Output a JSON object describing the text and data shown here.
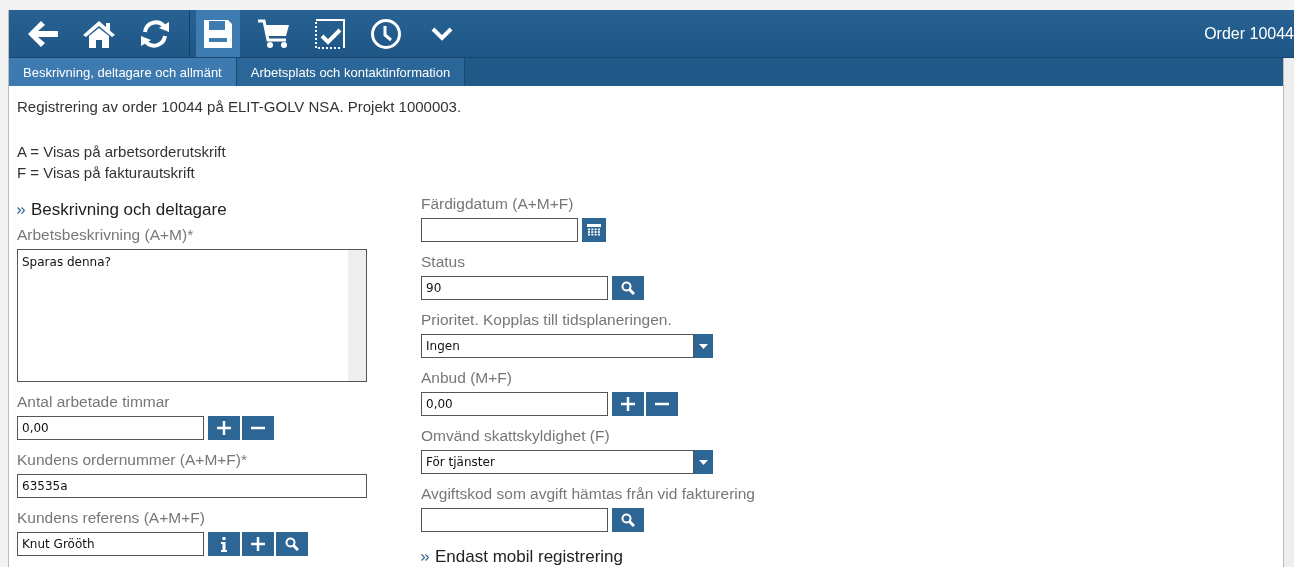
{
  "toolbar": {
    "buttons": [
      {
        "kind": "back",
        "selected": false
      },
      {
        "kind": "home",
        "selected": false
      },
      {
        "kind": "refresh",
        "selected": false
      },
      {
        "kind": "save",
        "selected": true
      },
      {
        "kind": "cart",
        "selected": false
      },
      {
        "kind": "check",
        "selected": false
      },
      {
        "kind": "clock",
        "selected": false
      },
      {
        "kind": "more",
        "selected": false
      }
    ],
    "title": "Order 10044"
  },
  "tabs": [
    {
      "label": "Beskrivning, deltagare och allmänt",
      "selected": true
    },
    {
      "label": "Arbetsplats och kontaktinformation",
      "selected": false
    }
  ],
  "intro": [
    "Registrering av order 10044 på ELIT-GOLV NSA. Projekt 1000003."
  ],
  "legend": [
    "A = Visas på arbetsorderutskrift",
    "F = Visas på fakturautskrift"
  ],
  "left": {
    "heading": "Beskrivning och deltagare",
    "fields": [
      {
        "kind": "textarea",
        "label": "Arbetsbeskrivning (A+M)*",
        "value": "Sparas denna?"
      },
      {
        "kind": "short",
        "label": "Antal arbetade timmar",
        "value": "0,00",
        "buttons": [
          {
            "kind": "plus"
          },
          {
            "kind": "minus"
          }
        ]
      },
      {
        "kind": "long",
        "label": "Kundens ordernummer (A+M+F)*",
        "value": "63535a"
      },
      {
        "kind": "short",
        "label": "Kundens referens (A+M+F)",
        "value": "Knut Grööth",
        "buttons": [
          {
            "kind": "info"
          },
          {
            "kind": "plus"
          },
          {
            "kind": "search"
          }
        ]
      }
    ]
  },
  "right": {
    "fields": [
      {
        "kind": "date",
        "label": "Färdigdatum (A+M+F)",
        "buttons": [
          {
            "kind": "calendar"
          }
        ]
      },
      {
        "kind": "short",
        "label": "Status",
        "value": "90",
        "buttons": [
          {
            "kind": "search"
          }
        ]
      },
      {
        "kind": "select",
        "label": "Prioritet. Kopplas till tidsplaneringen.",
        "value": "Ingen"
      },
      {
        "kind": "short",
        "label": "Anbud (M+F)",
        "value": "0,00",
        "buttons": [
          {
            "kind": "plus"
          },
          {
            "kind": "minus"
          }
        ]
      },
      {
        "kind": "select",
        "label": "Omvänd skattskyldighet (F)",
        "value": "För tjänster"
      },
      {
        "kind": "short",
        "label": "Avgiftskod som avgift hämtas från vid fakturering",
        "buttons": [
          {
            "kind": "search"
          }
        ]
      }
    ],
    "heading": "Endast mobil registrering"
  }
}
